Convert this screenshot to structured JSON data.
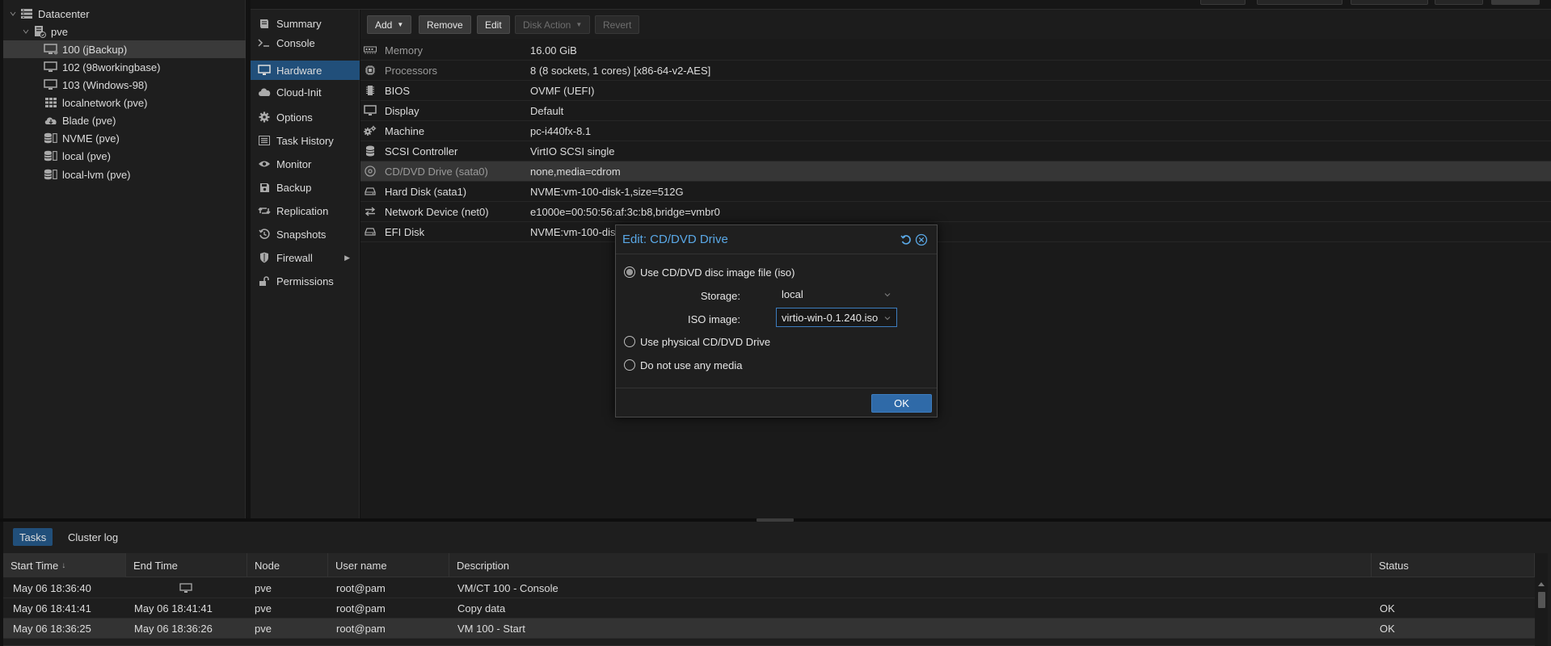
{
  "tree": {
    "items": [
      {
        "label": "Datacenter",
        "icon": "datacenter-icon"
      },
      {
        "label": "pve",
        "icon": "node-icon"
      },
      {
        "label": "100 (jBackup)",
        "icon": "vm-monitor-icon"
      },
      {
        "label": "102 (98workingbase)",
        "icon": "vm-monitor-icon"
      },
      {
        "label": "103 (Windows-98)",
        "icon": "vm-monitor-icon"
      },
      {
        "label": "localnetwork (pve)",
        "icon": "network-grid-icon"
      },
      {
        "label": "Blade (pve)",
        "icon": "cloud-storage-icon"
      },
      {
        "label": "NVME (pve)",
        "icon": "storage-icon"
      },
      {
        "label": "local (pve)",
        "icon": "storage-icon"
      },
      {
        "label": "local-lvm (pve)",
        "icon": "storage-icon"
      }
    ]
  },
  "vm_nav": {
    "items": [
      {
        "label": "Summary",
        "icon": "summary-book-icon"
      },
      {
        "label": "Console",
        "icon": "terminal-icon"
      },
      {
        "label": "Hardware",
        "icon": "desktop-icon"
      },
      {
        "label": "Cloud-Init",
        "icon": "cloud-icon"
      },
      {
        "label": "Options",
        "icon": "gear-icon"
      },
      {
        "label": "Task History",
        "icon": "list-icon"
      },
      {
        "label": "Monitor",
        "icon": "eye-icon"
      },
      {
        "label": "Backup",
        "icon": "floppy-icon"
      },
      {
        "label": "Replication",
        "icon": "retweet-icon"
      },
      {
        "label": "Snapshots",
        "icon": "history-icon"
      },
      {
        "label": "Firewall",
        "icon": "shield-icon"
      },
      {
        "label": "Permissions",
        "icon": "unlock-icon"
      }
    ]
  },
  "toolbar": {
    "add_label": "Add",
    "remove_label": "Remove",
    "edit_label": "Edit",
    "disk_action_label": "Disk Action",
    "revert_label": "Revert"
  },
  "hardware": {
    "rows": [
      {
        "name": "Memory",
        "value": "16.00 GiB",
        "icon": "memory-icon"
      },
      {
        "name": "Processors",
        "value": "8 (8 sockets, 1 cores) [x86-64-v2-AES]",
        "icon": "cpu-icon"
      },
      {
        "name": "BIOS",
        "value": "OVMF (UEFI)",
        "icon": "microchip-icon"
      },
      {
        "name": "Display",
        "value": "Default",
        "icon": "desktop-icon"
      },
      {
        "name": "Machine",
        "value": "pc-i440fx-8.1",
        "icon": "cogs-icon"
      },
      {
        "name": "SCSI Controller",
        "value": "VirtIO SCSI single",
        "icon": "database-icon"
      },
      {
        "name": "CD/DVD Drive (sata0)",
        "value": "none,media=cdrom",
        "icon": "cdrom-icon"
      },
      {
        "name": "Hard Disk (sata1)",
        "value": "NVME:vm-100-disk-1,size=512G",
        "icon": "hdd-icon"
      },
      {
        "name": "Network Device (net0)",
        "value": "e1000e=00:50:56:af:3c:b8,bridge=vmbr0",
        "icon": "exchange-icon"
      },
      {
        "name": "EFI Disk",
        "value": "NVME:vm-100-disk-0",
        "icon": "hdd-icon"
      }
    ]
  },
  "dialog": {
    "title": "Edit: CD/DVD Drive",
    "option_iso": "Use CD/DVD disc image file (iso)",
    "storage_label": "Storage:",
    "storage_value": "local",
    "iso_label": "ISO image:",
    "iso_value": "virtio-win-0.1.240.iso",
    "option_physical": "Use physical CD/DVD Drive",
    "option_none": "Do not use any media",
    "ok_label": "OK"
  },
  "bottom": {
    "tabs": [
      "Tasks",
      "Cluster log"
    ],
    "columns": [
      "Start Time",
      "End Time",
      "Node",
      "User name",
      "Description",
      "Status"
    ],
    "sort_indicator": "↓",
    "rows": [
      {
        "start": "May 06 18:36:40",
        "end": "",
        "node": "pve",
        "user": "root@pam",
        "description": "VM/CT 100 - Console",
        "status": ""
      },
      {
        "start": "May 06 18:41:41",
        "end": "May 06 18:41:41",
        "node": "pve",
        "user": "root@pam",
        "description": "Copy data",
        "status": "OK"
      },
      {
        "start": "May 06 18:36:25",
        "end": "May 06 18:36:26",
        "node": "pve",
        "user": "root@pam",
        "description": "VM 100 - Start",
        "status": "OK"
      }
    ]
  },
  "colors": {
    "accent": "#214f7a",
    "dialog_title": "#5aa8e6",
    "ok_button": "#2f6aa8"
  }
}
